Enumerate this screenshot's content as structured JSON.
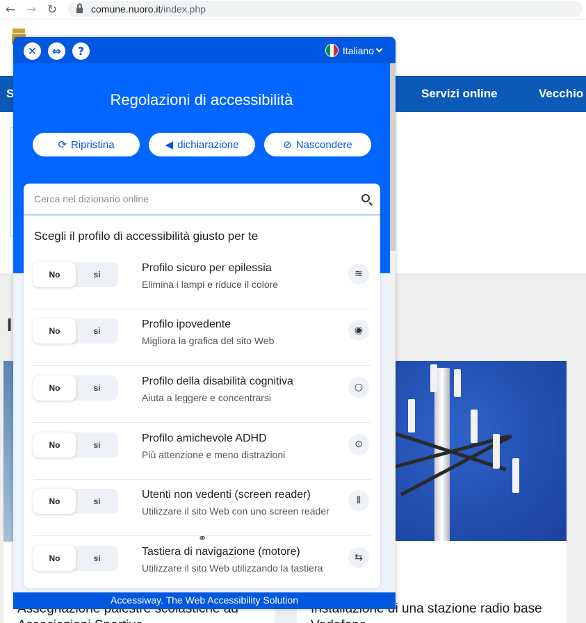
{
  "browser": {
    "back": "←",
    "forward": "→",
    "reload": "↻",
    "url_domain": "comune.nuoro.it",
    "url_path": "/index.php"
  },
  "site": {
    "nav_left_fragment": "S",
    "nav_items": [
      "Servizi online",
      "Vecchio s"
    ],
    "section_title_fragment": "I",
    "news_left_title": "Assegnazione palestre scolastiche ad Associazioni Sportive",
    "news_right_title": "Installazione di una stazione radio base Vodafone"
  },
  "panel": {
    "language": "Italiano",
    "title": "Regolazioni di accessibilità",
    "buttons": {
      "reset": "Ripristina",
      "statement": "dichiarazione",
      "hide": "Nascondere"
    },
    "search_placeholder": "Cerca nel dizionario online",
    "heading": "Scegli il profilo di accessibilità giusto per te",
    "toggle_no": "No",
    "toggle_yes": "si",
    "profiles": [
      {
        "name": "Profilo sicuro per epilessia",
        "desc": "Elimina i lampi e riduce il colore",
        "icon": "wave-icon",
        "glyph": "≋"
      },
      {
        "name": "Profilo ipovedente",
        "desc": "Migliora la grafica del sito Web",
        "icon": "eye-icon",
        "glyph": "◉"
      },
      {
        "name": "Profilo della disabilità cognitiva",
        "desc": "Aiuta a leggere e concentrarsi",
        "icon": "brain-icon",
        "glyph": "○"
      },
      {
        "name": "Profilo amichevole ADHD",
        "desc": "Più attenzione e meno distrazioni",
        "icon": "focus-icon",
        "glyph": "⊙"
      },
      {
        "name": "Utenti non vedenti (screen reader)",
        "desc": "Utilizzare il sito Web con uno screen reader",
        "icon": "audio-icon",
        "glyph": "⦀"
      },
      {
        "name": "Tastiera di navigazione (motore)",
        "desc": "Utilizzare il sito Web utilizzando la tastiera",
        "icon": "swap-arrows-icon",
        "glyph": "⇆"
      }
    ],
    "footer": "Accessiway. The Web Accessibility Solution"
  }
}
